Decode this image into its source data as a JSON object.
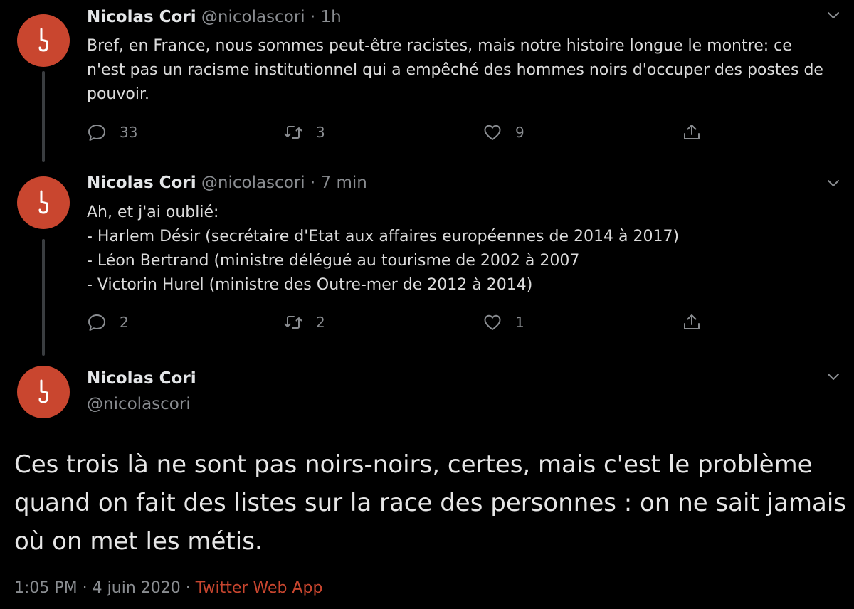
{
  "theme": {
    "background": "#000000",
    "avatar_color": "#c9462f",
    "accent": "#c9462f",
    "muted": "#8a8d91"
  },
  "tweets": [
    {
      "name": "Nicolas Cori",
      "handle": "@nicolascori",
      "separator": "·",
      "time": "1h",
      "text": "Bref, en France, nous sommes peut-être racistes, mais notre histoire longue le montre: ce n'est pas un racisme institutionnel qui a empêché des hommes noirs d'occuper des postes de pouvoir.",
      "replies": "33",
      "retweets": "3",
      "likes": "9"
    },
    {
      "name": "Nicolas Cori",
      "handle": "@nicolascori",
      "separator": "·",
      "time": "7 min",
      "text": "Ah, et j'ai oublié:\n- Harlem Désir (secrétaire d'Etat aux affaires européennes de 2014 à 2017)\n- Léon Bertrand (ministre délégué au tourisme de 2002 à 2007\n- Victorin Hurel (ministre des Outre-mer de 2012 à 2014)",
      "replies": "2",
      "retweets": "2",
      "likes": "1"
    }
  ],
  "main_tweet": {
    "name": "Nicolas Cori",
    "handle": "@nicolascori",
    "text": "Ces trois là ne sont pas noirs-noirs, certes, mais c'est le problème quand on fait des listes sur la race des personnes : on ne sait jamais où on met les métis.",
    "time": "1:05 PM",
    "separator": "·",
    "date": "4 juin 2020",
    "separator2": "·",
    "source": "Twitter Web App"
  },
  "icons": {
    "avatar": "logo-avatar-icon",
    "reply": "reply-icon",
    "retweet": "retweet-icon",
    "like": "heart-icon",
    "share": "share-icon",
    "more": "chevron-down-icon"
  }
}
